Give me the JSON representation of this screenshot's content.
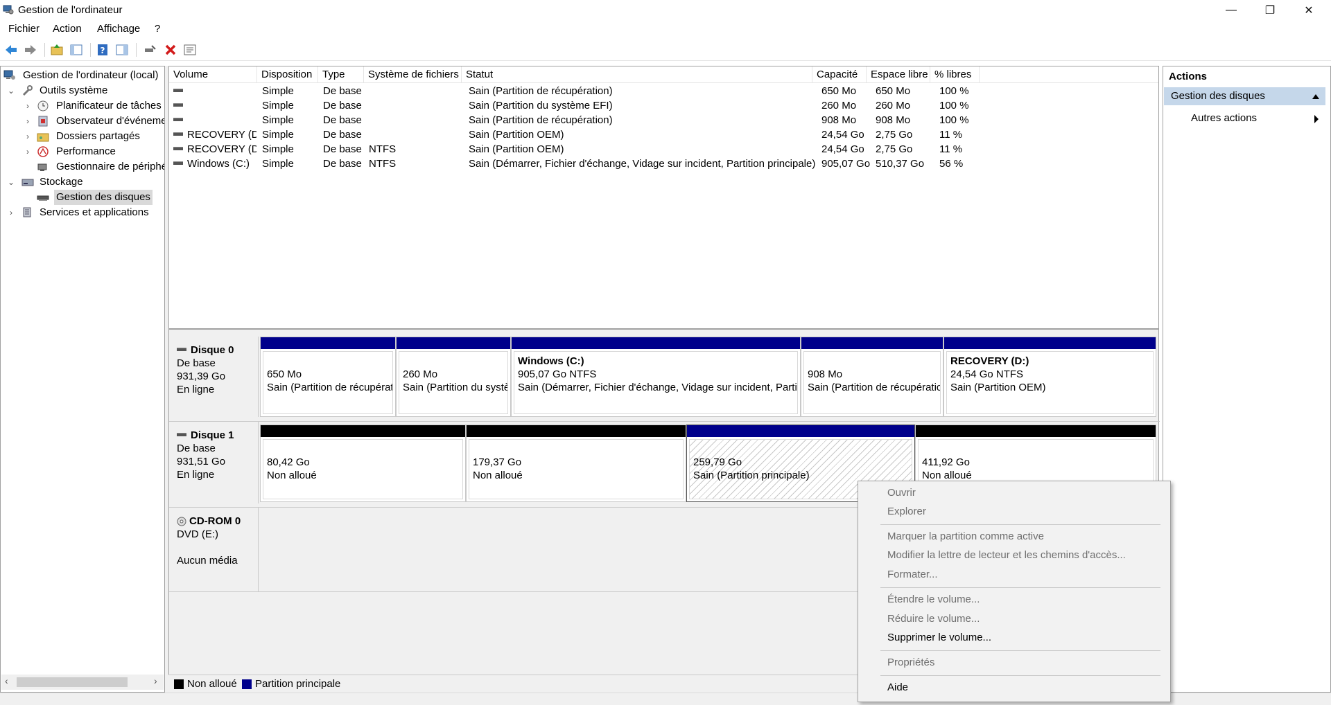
{
  "window": {
    "title": "Gestion de l'ordinateur",
    "minimize": "—",
    "restore": "❐",
    "close": "✕"
  },
  "menu": [
    "Fichier",
    "Action",
    "Affichage",
    "?"
  ],
  "tree": {
    "root": "Gestion de l'ordinateur (local)",
    "system_tools": "Outils système",
    "task_scheduler": "Planificateur de tâches",
    "event_viewer": "Observateur d'événeme",
    "shared_folders": "Dossiers partagés",
    "performance": "Performance",
    "device_manager": "Gestionnaire de périphé",
    "storage": "Stockage",
    "disk_management": "Gestion des disques",
    "services": "Services et applications"
  },
  "volumes": {
    "columns": [
      "Volume",
      "Disposition",
      "Type",
      "Système de fichiers",
      "Statut",
      "Capacité",
      "Espace libre",
      "% libres"
    ],
    "rows": [
      {
        "volume": "",
        "layout": "Simple",
        "type": "De base",
        "fs": "",
        "status": "Sain (Partition de récupération)",
        "capacity": "650 Mo",
        "free": "650 Mo",
        "pct": "100 %"
      },
      {
        "volume": "",
        "layout": "Simple",
        "type": "De base",
        "fs": "",
        "status": "Sain (Partition du système EFI)",
        "capacity": "260 Mo",
        "free": "260 Mo",
        "pct": "100 %"
      },
      {
        "volume": "",
        "layout": "Simple",
        "type": "De base",
        "fs": "",
        "status": "Sain (Partition de récupération)",
        "capacity": "908 Mo",
        "free": "908 Mo",
        "pct": "100 %"
      },
      {
        "volume": "RECOVERY (D:)",
        "layout": "Simple",
        "type": "De base",
        "fs": "",
        "status": "Sain (Partition OEM)",
        "capacity": "24,54 Go",
        "free": "2,75 Go",
        "pct": "11 %"
      },
      {
        "volume": "RECOVERY (D:)",
        "layout": "Simple",
        "type": "De base",
        "fs": "NTFS",
        "status": "Sain (Partition OEM)",
        "capacity": "24,54 Go",
        "free": "2,75 Go",
        "pct": "11 %"
      },
      {
        "volume": "Windows (C:)",
        "layout": "Simple",
        "type": "De base",
        "fs": "NTFS",
        "status": "Sain (Démarrer, Fichier d'échange, Vidage sur incident, Partition principale)",
        "capacity": "905,07 Go",
        "free": "510,37 Go",
        "pct": "56 %"
      }
    ]
  },
  "disks": {
    "disk0": {
      "name": "Disque 0",
      "kind": "De base",
      "size": "931,39 Go",
      "state": "En ligne",
      "parts": [
        {
          "title": "",
          "line1": "650 Mo",
          "line2": "Sain (Partition de récupérat"
        },
        {
          "title": "",
          "line1": "260 Mo",
          "line2": "Sain (Partition du systè"
        },
        {
          "title": "Windows  (C:)",
          "line1": "905,07 Go NTFS",
          "line2": "Sain (Démarrer, Fichier d'échange, Vidage sur incident, Partit"
        },
        {
          "title": "",
          "line1": "908 Mo",
          "line2": "Sain (Partition de récupératic"
        },
        {
          "title": "RECOVERY  (D:)",
          "line1": "24,54 Go NTFS",
          "line2": "Sain (Partition OEM)"
        }
      ]
    },
    "disk1": {
      "name": "Disque 1",
      "kind": "De base",
      "size": "931,51 Go",
      "state": "En ligne",
      "parts": [
        {
          "line1": "80,42 Go",
          "line2": "Non alloué"
        },
        {
          "line1": "179,37 Go",
          "line2": "Non alloué"
        },
        {
          "line1": "259,79 Go",
          "line2": "Sain (Partition principale)"
        },
        {
          "line1": "411,92 Go",
          "line2": "Non alloué"
        }
      ]
    },
    "cdrom": {
      "name": "CD-ROM 0",
      "kind": "DVD (E:)",
      "state": "Aucun média"
    }
  },
  "legend": {
    "unallocated": "Non alloué",
    "primary": "Partition principale"
  },
  "colors": {
    "unallocated": "#000000",
    "primary": "#00008b",
    "selection": "#c5d7ea"
  },
  "actions": {
    "header": "Actions",
    "section": "Gestion des disques",
    "more": "Autres actions"
  },
  "context_menu": {
    "open": "Ouvrir",
    "explore": "Explorer",
    "mark_active": "Marquer la partition comme active",
    "change_letter": "Modifier la lettre de lecteur et les chemins d'accès...",
    "format": "Formater...",
    "extend": "Étendre le volume...",
    "shrink": "Réduire le volume...",
    "delete": "Supprimer le volume...",
    "properties": "Propriétés",
    "help": "Aide"
  }
}
